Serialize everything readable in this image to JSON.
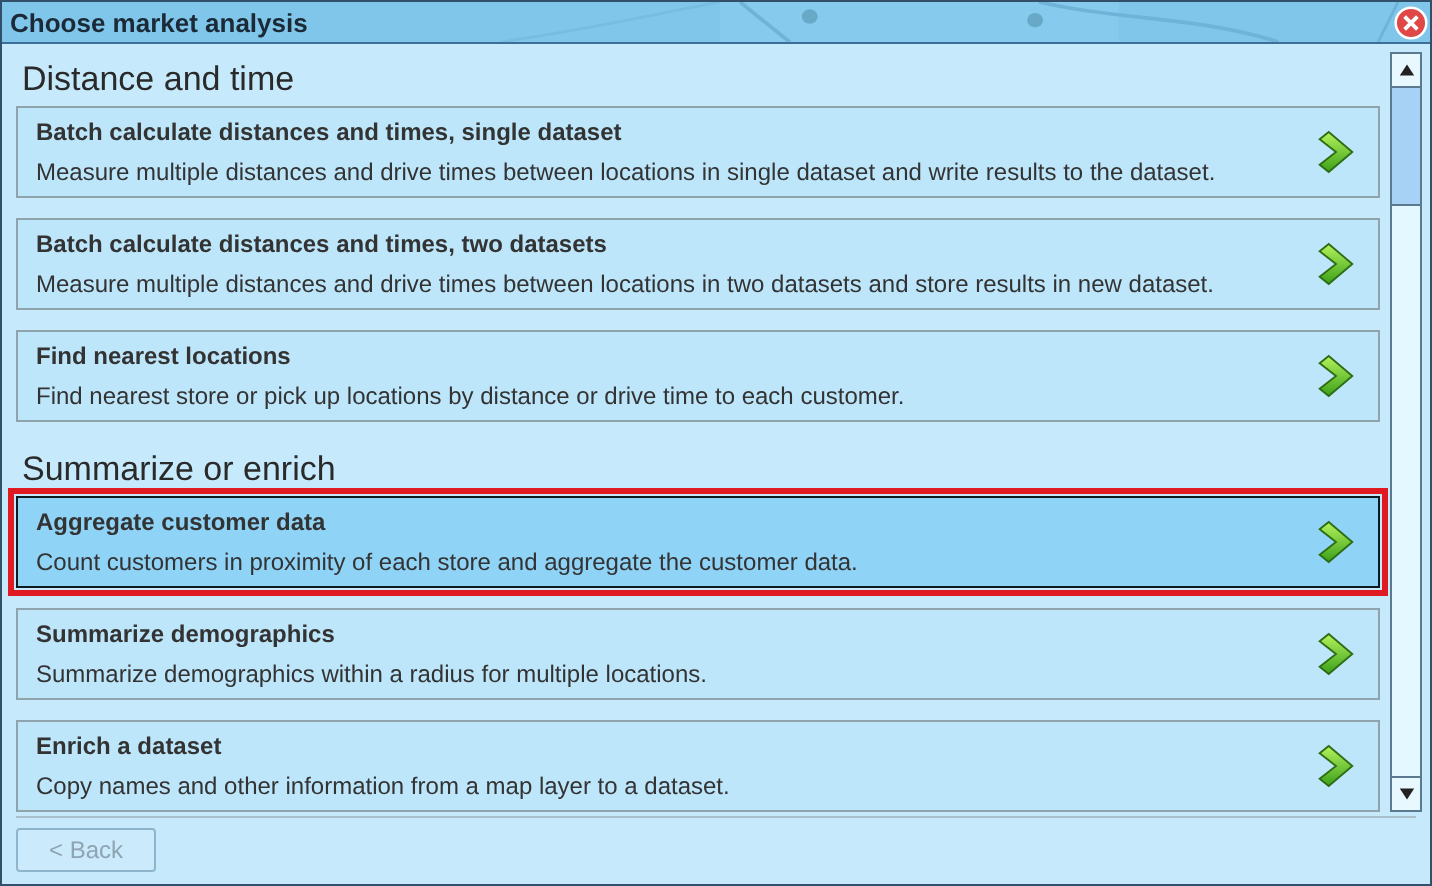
{
  "window": {
    "title": "Choose market analysis"
  },
  "sections": [
    {
      "heading": "Distance and time",
      "items": [
        {
          "title": "Batch calculate distances and times, single dataset",
          "description": "Measure multiple distances and drive times between locations in single dataset and write results to the dataset.",
          "selected": false
        },
        {
          "title": "Batch calculate distances and times, two datasets",
          "description": "Measure multiple distances and drive times between locations in two datasets and store results in new dataset.",
          "selected": false
        },
        {
          "title": "Find nearest locations",
          "description": "Find nearest store or pick up locations by distance or drive time to each customer.",
          "selected": false
        }
      ]
    },
    {
      "heading": "Summarize or enrich",
      "items": [
        {
          "title": "Aggregate customer data",
          "description": "Count customers in proximity of each store and aggregate the customer data.",
          "selected": true
        },
        {
          "title": "Summarize demographics",
          "description": "Summarize demographics within a radius for multiple locations.",
          "selected": false
        },
        {
          "title": "Enrich a dataset",
          "description": "Copy names and other information from a map layer to a dataset.",
          "selected": false
        }
      ]
    }
  ],
  "back_button": {
    "label": "< Back",
    "disabled": true
  }
}
